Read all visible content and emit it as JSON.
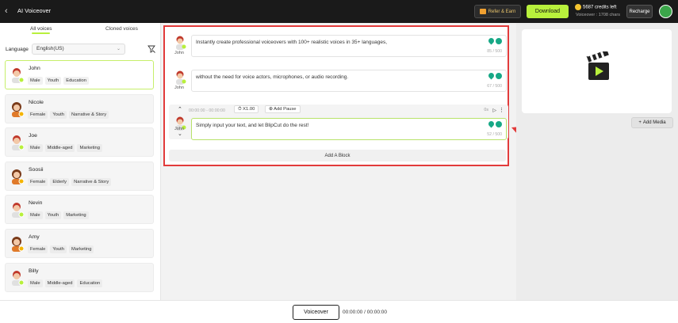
{
  "header": {
    "title": "AI Voiceover",
    "refer_label": "Refer & Earn",
    "download_label": "Download",
    "credits": "5687 credits left",
    "voiceover_chars": "Voiceover : 1708 chars",
    "recharge_label": "Recharge"
  },
  "left_panel": {
    "tabs": [
      {
        "label": "All voices"
      },
      {
        "label": "Cloned voices"
      }
    ],
    "language_label": "Language",
    "language_value": "English(US)",
    "voices": [
      {
        "name": "John",
        "tags": [
          "Male",
          "Youth",
          "Education"
        ],
        "selected": true
      },
      {
        "name": "Nicole",
        "tags": [
          "Female",
          "Youth",
          "Narrative & Story"
        ]
      },
      {
        "name": "Joe",
        "tags": [
          "Male",
          "Middle-aged",
          "Marketing"
        ]
      },
      {
        "name": "Soosii",
        "tags": [
          "Female",
          "Elderly",
          "Narrative & Story"
        ]
      },
      {
        "name": "Nevin",
        "tags": [
          "Male",
          "Youth",
          "Marketing"
        ]
      },
      {
        "name": "Amy",
        "tags": [
          "Female",
          "Youth",
          "Marketing"
        ]
      },
      {
        "name": "Billy",
        "tags": [
          "Male",
          "Middle-aged",
          "Education"
        ]
      }
    ]
  },
  "editor": {
    "blocks": [
      {
        "voice": "John",
        "text": "Instantly create professional voiceovers with 100+ realistic voices in 35+ languages,",
        "count": "85 / 500"
      },
      {
        "voice": "John",
        "text": "without the need for voice actors, microphones, or audio recording.",
        "count": "67 / 500"
      },
      {
        "voice": "John",
        "text": "Simply input your text, and let BlipCut do the rest!",
        "count": "52 / 500"
      }
    ],
    "controls": {
      "time": "00:00:00 - 00:00:00",
      "speed": "X1.00",
      "pause_label": "Add Pause",
      "duration": "0s"
    },
    "add_block_label": "Add A Block"
  },
  "right_panel": {
    "add_media_label": "Add Media"
  },
  "footer": {
    "voiceover_label": "Voiceover",
    "time": "00:00:00 / 00:00:00"
  },
  "colors": {
    "accent": "#b8f03c",
    "highlight_border": "#e23b3b",
    "icon_teal": "#17a886"
  }
}
